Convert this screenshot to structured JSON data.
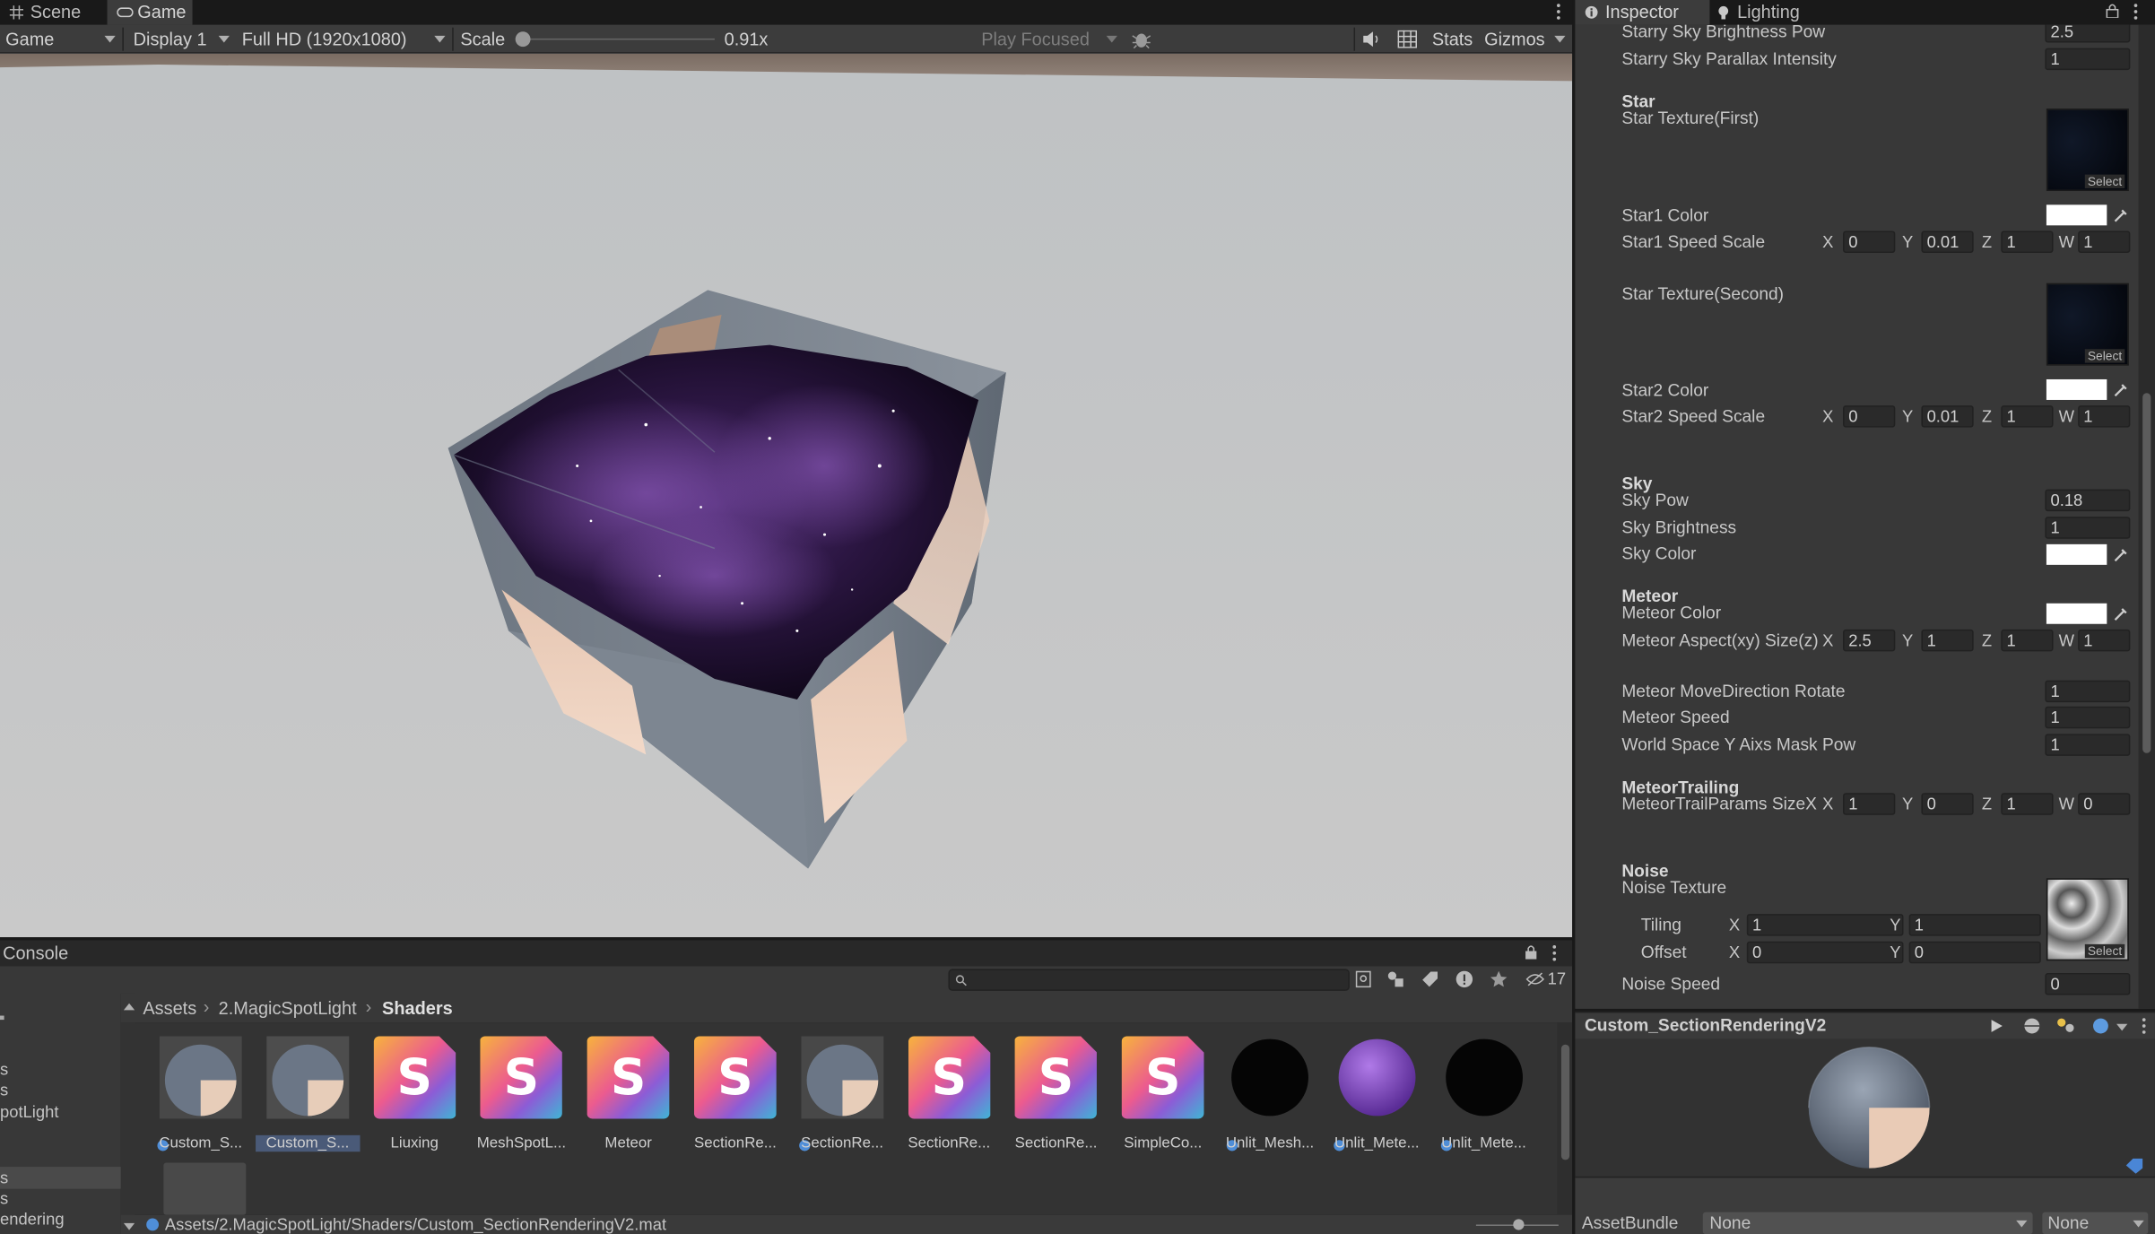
{
  "game_panel": {
    "tabs": [
      {
        "label": "Scene",
        "icon": "grid-icon"
      },
      {
        "label": "Game",
        "icon": "gamepad-icon"
      }
    ],
    "toolbar": {
      "game_mode": "Game",
      "display": "Display 1",
      "resolution": "Full HD (1920x1080)",
      "scale_label": "Scale",
      "scale_value": "0.91x",
      "scale_fraction": 0.0,
      "play_mode": "Play Focused",
      "stats": "Stats",
      "gizmos": "Gizmos"
    }
  },
  "console": {
    "title": "Console",
    "hidden_count": "17",
    "breadcrumb": [
      "Assets",
      "2.MagicSpotLight",
      "Shaders"
    ],
    "tree_items": [
      "s",
      "s",
      "potLight",
      "s",
      "s",
      "endering"
    ],
    "assets": [
      {
        "label": "Custom_S...",
        "kind": "material-dome",
        "linked": true
      },
      {
        "label": "Custom_S...",
        "kind": "material-dome",
        "linked": true,
        "selected": true
      },
      {
        "label": "Liuxing",
        "kind": "shader"
      },
      {
        "label": "MeshSpotL...",
        "kind": "shader"
      },
      {
        "label": "Meteor",
        "kind": "shader"
      },
      {
        "label": "SectionRe...",
        "kind": "shader"
      },
      {
        "label": "SectionRe...",
        "kind": "material-dome",
        "linked": true
      },
      {
        "label": "SectionRe...",
        "kind": "shader"
      },
      {
        "label": "SectionRe...",
        "kind": "shader"
      },
      {
        "label": "SimpleCo...",
        "kind": "shader"
      },
      {
        "label": "Unlit_Mesh...",
        "kind": "material-black",
        "linked": true
      },
      {
        "label": "Unlit_Mete...",
        "kind": "material-purple",
        "linked": true
      },
      {
        "label": "Unlit_Mete...",
        "kind": "material-black",
        "linked": true
      }
    ],
    "status_path": "Assets/2.MagicSpotLight/Shaders/Custom_SectionRenderingV2.mat"
  },
  "inspector": {
    "tabs": [
      {
        "label": "Inspector",
        "icon": "info-icon"
      },
      {
        "label": "Lighting",
        "icon": "bulb-icon"
      }
    ],
    "rows": {
      "starry_brightness_label": "Starry Sky Brightness Pow",
      "starry_brightness_value": "2.5",
      "starry_parallax_label": "Starry Sky Parallax Intensity",
      "starry_parallax_value": "1",
      "star_header": "Star",
      "star_tex1_label": "Star Texture(First)",
      "star1_color_label": "Star1 Color",
      "star1_speed_label": "Star1 Speed Scale",
      "star1_speed": {
        "x": "0",
        "y": "0.01",
        "z": "1",
        "w": "1"
      },
      "star_tex2_label": "Star Texture(Second)",
      "star2_color_label": "Star2 Color",
      "star2_speed_label": "Star2 Speed Scale",
      "star2_speed": {
        "x": "0",
        "y": "0.01",
        "z": "1",
        "w": "1"
      },
      "sky_header": "Sky",
      "sky_pow_label": "Sky Pow",
      "sky_pow_value": "0.18",
      "sky_brightness_label": "Sky Brightness",
      "sky_brightness_value": "1",
      "sky_color_label": "Sky Color",
      "meteor_header": "Meteor",
      "meteor_color_label": "Meteor Color",
      "meteor_aspect_label": "Meteor Aspect(xy) Size(z)",
      "meteor_aspect": {
        "x": "2.5",
        "y": "1",
        "z": "1",
        "w": "1"
      },
      "meteor_rotate_label": "Meteor MoveDirection Rotate",
      "meteor_rotate_value": "1",
      "meteor_speed_label": "Meteor Speed",
      "meteor_speed_value": "1",
      "world_mask_label": "World Space Y Aixs Mask Pow",
      "world_mask_value": "1",
      "trailing_header": "MeteorTrailing",
      "trail_params_label": "MeteorTrailParams SizeX",
      "trail_params": {
        "x": "1",
        "y": "0",
        "z": "1",
        "w": "0"
      },
      "noise_header": "Noise",
      "noise_tex_label": "Noise Texture",
      "tiling_label": "Tiling",
      "tiling": {
        "x": "1",
        "y": "1"
      },
      "offset_label": "Offset",
      "offset": {
        "x": "0",
        "y": "0"
      },
      "noise_speed_label": "Noise Speed",
      "noise_speed_value": "0",
      "select_label": "Select",
      "axis": {
        "x": "X",
        "y": "Y",
        "z": "Z",
        "w": "W"
      }
    },
    "material_name": "Custom_SectionRenderingV2",
    "assetbundle_label": "AssetBundle",
    "assetbundle_value": "None",
    "assetbundle_variant": "None"
  },
  "colors": {
    "swatch": "#ffffff",
    "panel": "#383838"
  }
}
